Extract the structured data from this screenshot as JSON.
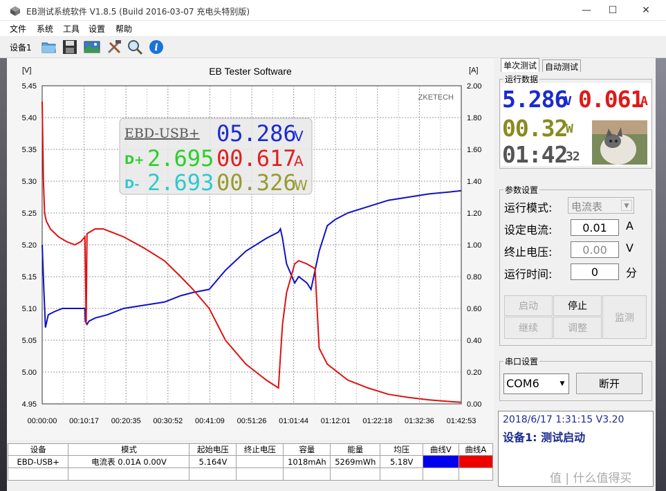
{
  "window": {
    "title": "EB测试系统软件 V1.8.5 (Build 2016-03-07 充电头特别版)",
    "minimize": "—",
    "maximize": "☐",
    "close": "✕"
  },
  "menu": [
    "文件",
    "系统",
    "工具",
    "设置",
    "帮助"
  ],
  "toolbar": {
    "device_tab": "设备1",
    "icons": [
      "open-folder-icon",
      "save-icon",
      "picture-icon",
      "tools-icon",
      "magnifier-icon",
      "info-icon"
    ]
  },
  "chart_data": {
    "type": "line",
    "title": "EB Tester Software",
    "watermark": "ZKETECH",
    "left_unit": "[V]",
    "right_unit": "[A]",
    "y_ticks": [
      "5.45",
      "5.40",
      "5.35",
      "5.30",
      "5.25",
      "5.20",
      "5.15",
      "5.10",
      "5.05",
      "5.00",
      "4.95"
    ],
    "y2_ticks": [
      "2.00",
      "1.80",
      "1.60",
      "1.40",
      "1.20",
      "1.00",
      "0.80",
      "0.60",
      "0.40",
      "0.20",
      "0.00"
    ],
    "x_ticks": [
      "00:00:00",
      "00:10:17",
      "00:20:35",
      "00:30:52",
      "00:41:09",
      "00:51:26",
      "01:01:44",
      "01:12:01",
      "01:22:18",
      "01:32:36",
      "01:42:53"
    ],
    "ylim": [
      4.95,
      5.45
    ],
    "y2lim": [
      0,
      2.0
    ],
    "xlim_min": [
      0,
      102.9
    ],
    "series": [
      {
        "name": "曲线V",
        "color": "#1010c8",
        "x": [
          0,
          0.4,
          0.8,
          1.5,
          3,
          5,
          7,
          9,
          10.5,
          10.6,
          11,
          11.5,
          13,
          16,
          20,
          25,
          30,
          34,
          37,
          41,
          45,
          50,
          55,
          58,
          58.5,
          59,
          60,
          62,
          63,
          65,
          66,
          68,
          70,
          72,
          75,
          80,
          85,
          90,
          95,
          100,
          102.9
        ],
        "y": [
          5.2,
          5.13,
          5.07,
          5.09,
          5.095,
          5.1,
          5.1,
          5.1,
          5.1,
          5.08,
          5.075,
          5.08,
          5.085,
          5.09,
          5.1,
          5.105,
          5.11,
          5.12,
          5.125,
          5.13,
          5.16,
          5.19,
          5.21,
          5.22,
          5.225,
          5.21,
          5.17,
          5.14,
          5.15,
          5.14,
          5.13,
          5.19,
          5.23,
          5.24,
          5.25,
          5.26,
          5.27,
          5.275,
          5.28,
          5.283,
          5.285
        ]
      },
      {
        "name": "曲线A",
        "color": "#e01010",
        "x": [
          0,
          0.3,
          0.6,
          1,
          2,
          4,
          6,
          8,
          9.5,
          10.5,
          10.8,
          11,
          13,
          15,
          17,
          20,
          25,
          30,
          34,
          37,
          41,
          45,
          50,
          55,
          58,
          58.5,
          59,
          60,
          62,
          63,
          65,
          67,
          67.5,
          68,
          70,
          75,
          80,
          85,
          90,
          95,
          100,
          102.9
        ],
        "y": [
          1.9,
          1.4,
          1.2,
          1.15,
          1.1,
          1.05,
          1.02,
          1.0,
          1.02,
          1.05,
          0.5,
          1.07,
          1.1,
          1.1,
          1.08,
          1.05,
          0.98,
          0.9,
          0.8,
          0.72,
          0.6,
          0.4,
          0.25,
          0.15,
          0.1,
          0.3,
          0.5,
          0.7,
          0.88,
          0.9,
          0.88,
          0.85,
          0.6,
          0.35,
          0.25,
          0.15,
          0.1,
          0.06,
          0.04,
          0.025,
          0.015,
          0.01
        ]
      }
    ],
    "overlay": {
      "name": "EBD-USB+",
      "v": "05.286",
      "v_unit": "V",
      "dp_label": "D+",
      "dp": "2.695",
      "a": "00.617",
      "a_unit": "A",
      "dm_label": "D-",
      "dm": "2.693",
      "w": "00.326",
      "w_unit": "W"
    }
  },
  "table": {
    "headers": [
      "设备",
      "模式",
      "起始电压",
      "终止电压",
      "容量",
      "能量",
      "均压",
      "曲线V",
      "曲线A"
    ],
    "row": [
      "EBD-USB+",
      "电流表  0.01A  0.00V",
      "5.164V",
      "",
      "1018mAh",
      "5269mWh",
      "5.18V",
      "",
      ""
    ],
    "curve_v_color": "#0000ee",
    "curve_a_color": "#ee0000"
  },
  "right": {
    "tabs": [
      "单次测试",
      "自动测试"
    ],
    "run_data_title": "运行数据",
    "voltage": "5.286",
    "voltage_unit": "V",
    "current": "0.061",
    "current_unit": "A",
    "power": "00.32",
    "power_unit": "W",
    "time": "01:42",
    "time_sec": "32",
    "params_title": "参数设置",
    "params": [
      {
        "label": "运行模式:",
        "value": "电流表",
        "unit": ""
      },
      {
        "label": "设定电流:",
        "value": "0.01",
        "unit": "A"
      },
      {
        "label": "终止电压:",
        "value": "0.00",
        "unit": "V"
      },
      {
        "label": "运行时间:",
        "value": "0",
        "unit": "分"
      }
    ],
    "buttons": {
      "start": "启动",
      "stop": "停止",
      "continue": "继续",
      "adjust": "调整",
      "monitor": "监测"
    },
    "serial_title": "串口设置",
    "com_port": "COM6",
    "disconnect": "断开",
    "status_line1": "2018/6/17 1:31:15  V3.20",
    "status_line2": "设备1: 测试启动",
    "watermark": "值 | 什么值得买"
  }
}
